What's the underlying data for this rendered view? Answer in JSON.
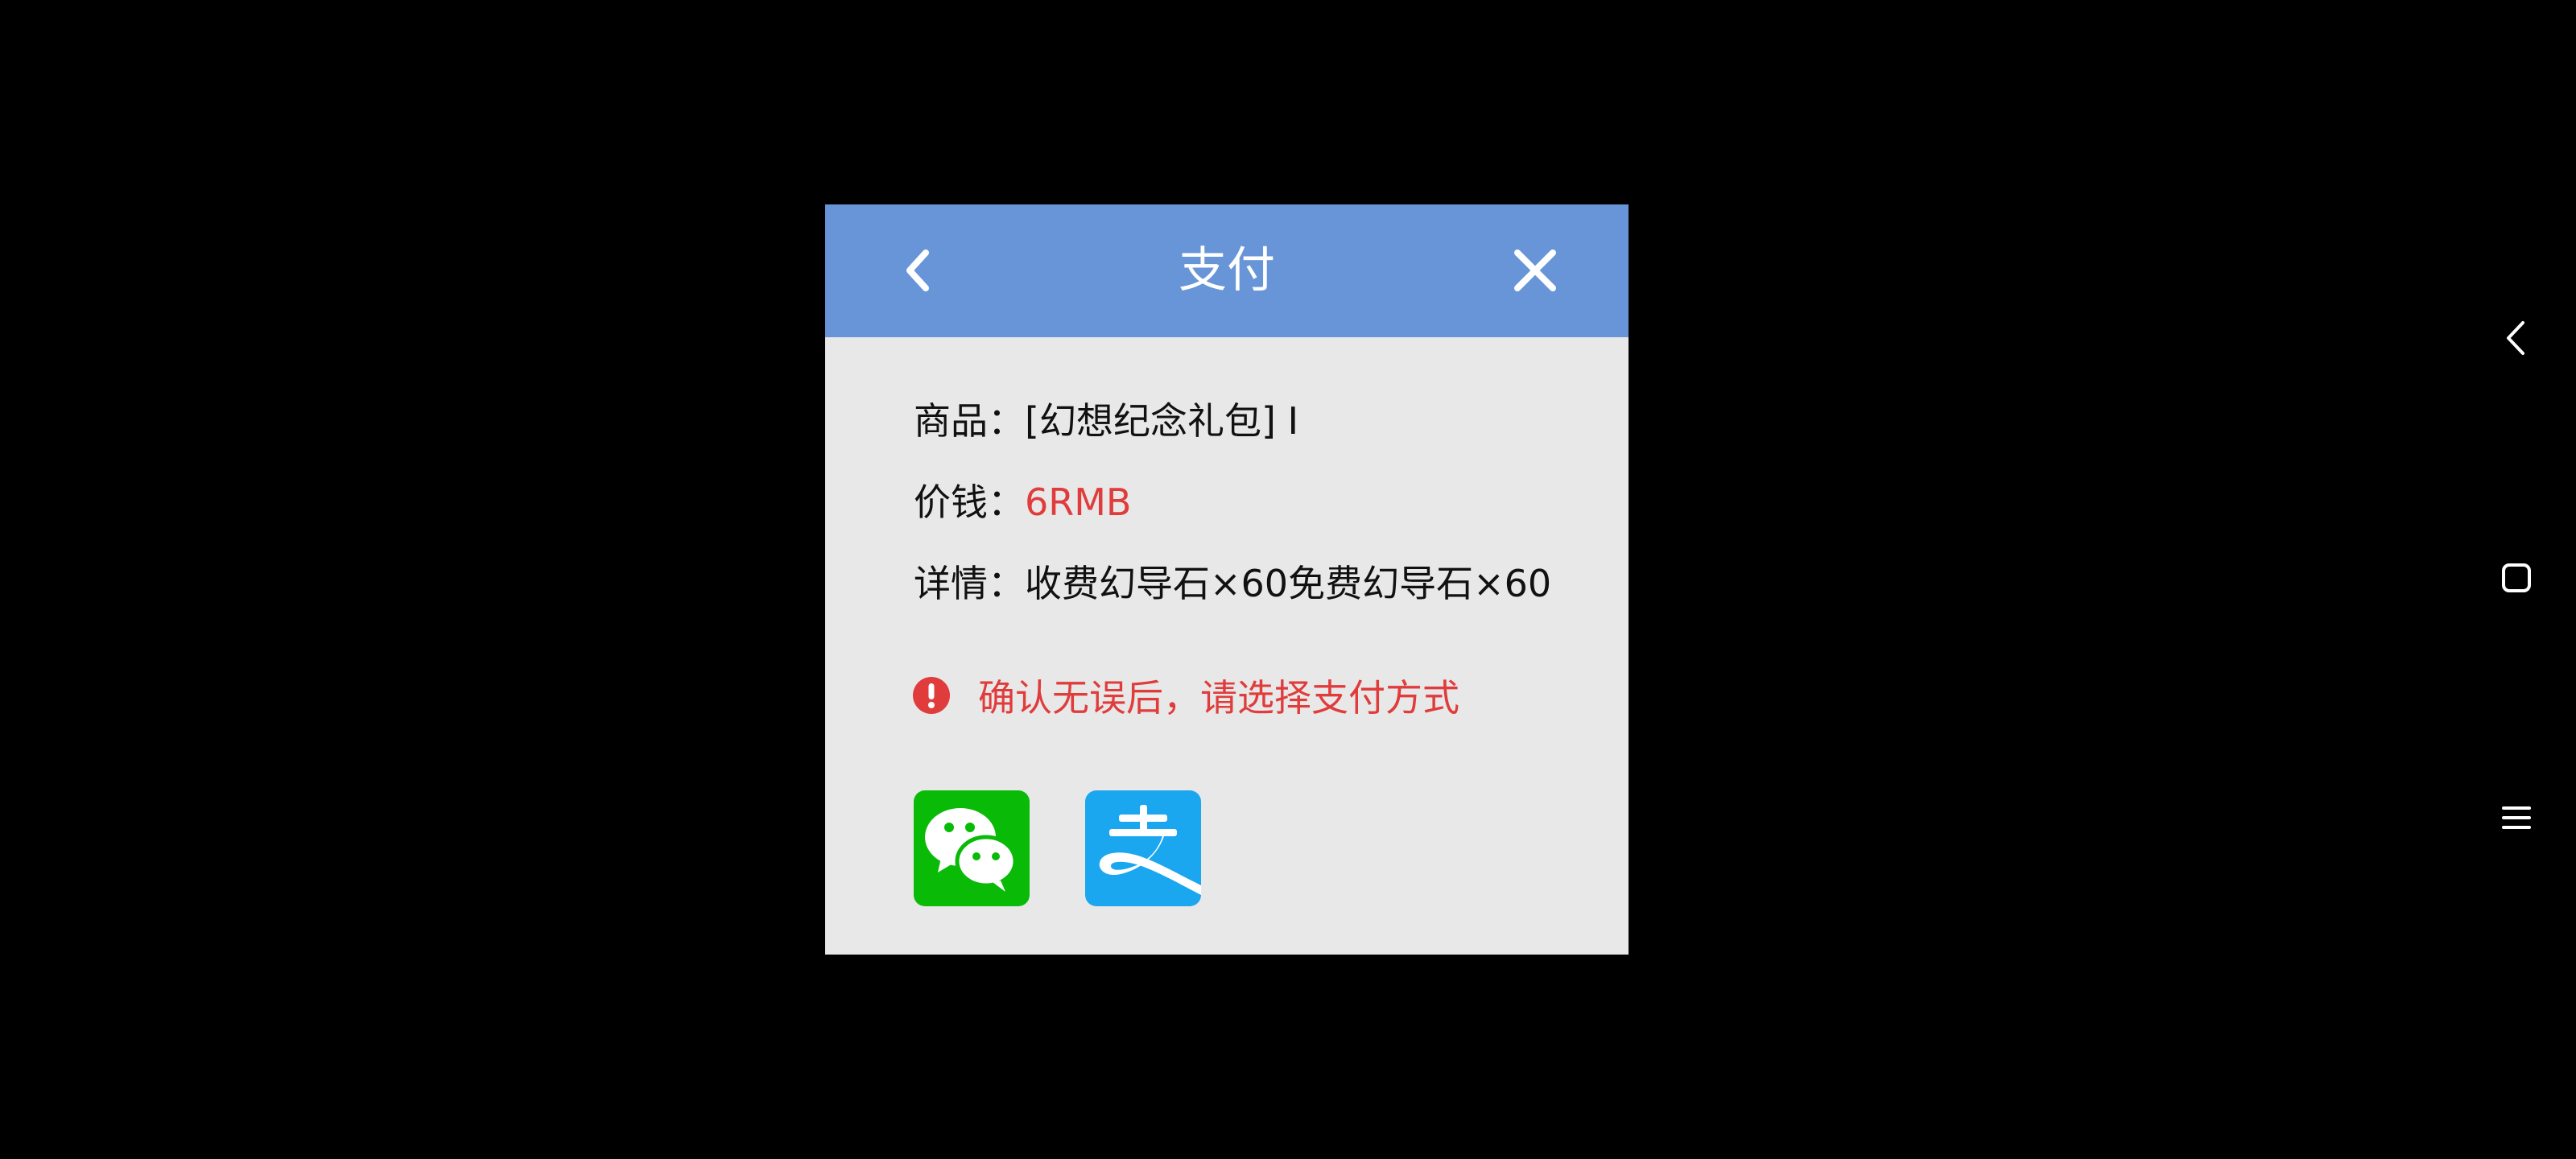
{
  "dialog": {
    "title": "支付",
    "product_label": "商品：",
    "product_value": "[幻想纪念礼包] I",
    "price_label": "价钱：",
    "price_value": "6RMB",
    "detail_label": "详情：",
    "detail_value": "收费幻导石×60免费幻导石×60",
    "notice_text": "确认无误后，请选择支付方式"
  },
  "icons": {
    "back": "chevron-left-icon",
    "close": "close-icon",
    "notice": "exclamation-circle-icon",
    "wechat": "wechat-pay-icon",
    "alipay": "alipay-icon",
    "nav_back": "nav-back-icon",
    "nav_home": "nav-home-icon",
    "nav_menu": "nav-menu-icon"
  },
  "colors": {
    "header": "#6895d8",
    "dialog_bg": "#e8e8e8",
    "accent_red": "#e03c3c",
    "wechat_green": "#09bb07",
    "alipay_blue": "#1aa7f0"
  }
}
